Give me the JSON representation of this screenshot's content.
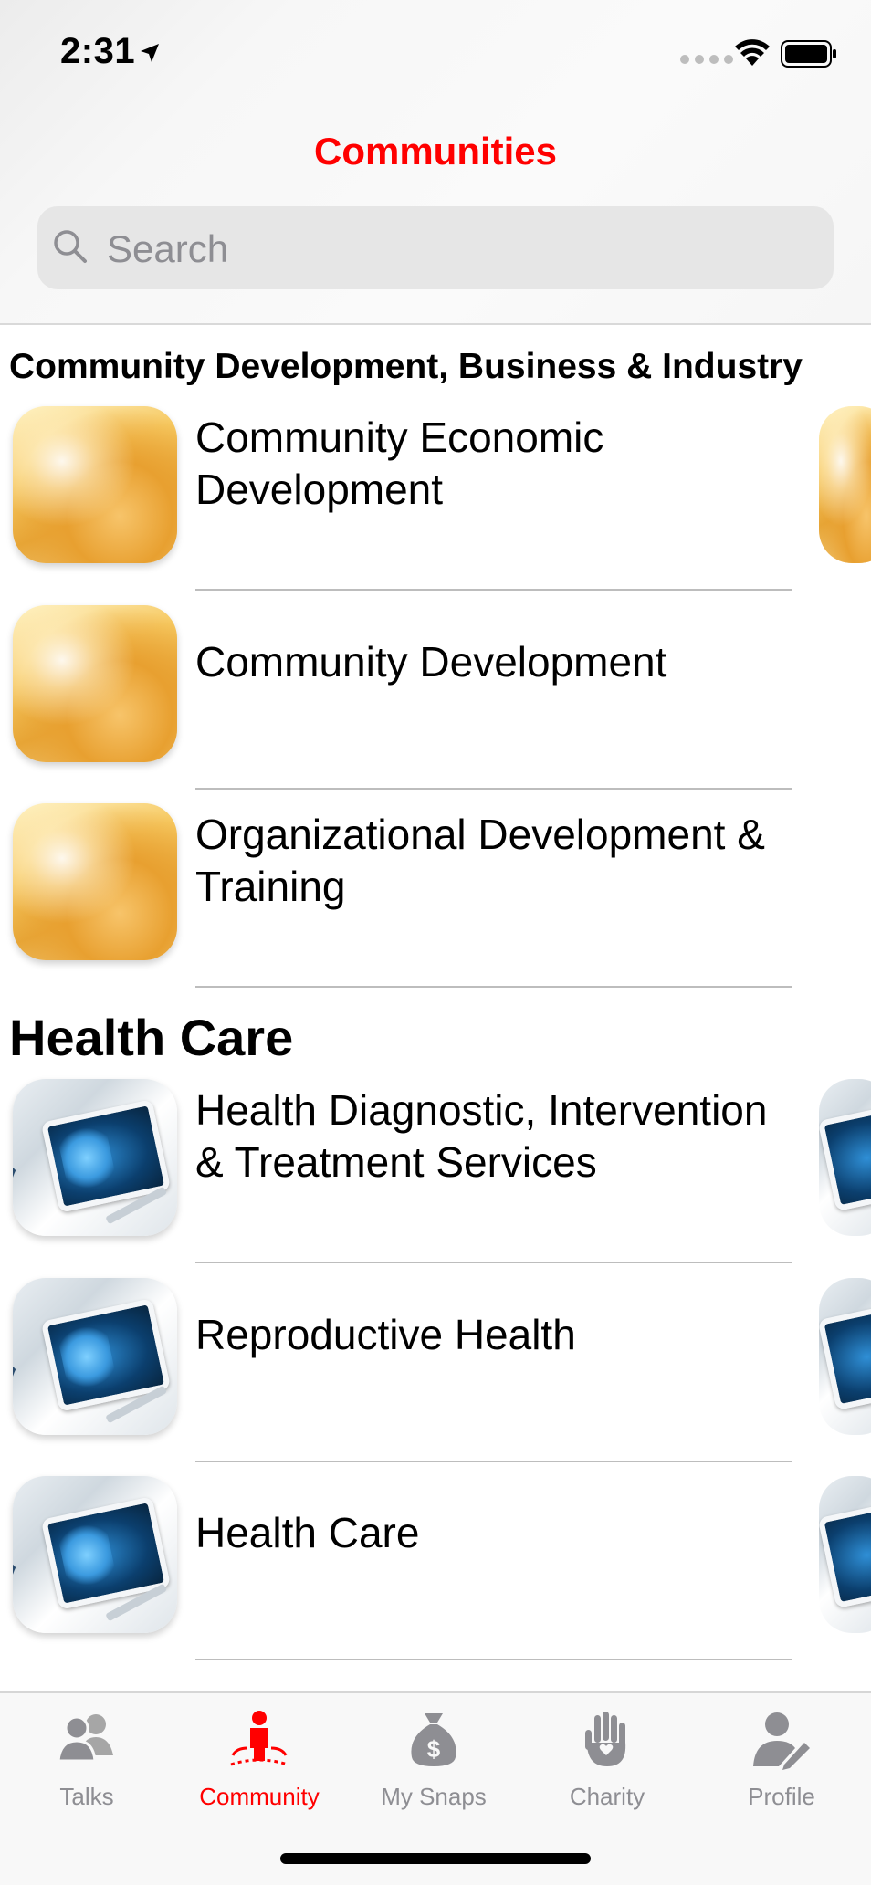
{
  "status_bar": {
    "time": "2:31"
  },
  "nav": {
    "title": "Communities"
  },
  "search": {
    "placeholder": "Search"
  },
  "sections": [
    {
      "title": "Community Development, Business & Industry",
      "items": [
        {
          "label": "Community Economic Development"
        },
        {
          "label": "Community Development"
        },
        {
          "label": "Organizational Development & Training"
        }
      ]
    },
    {
      "title": "Health Care",
      "items": [
        {
          "label": "Health Diagnostic, Intervention & Treatment Services"
        },
        {
          "label": "Reproductive Health"
        },
        {
          "label": "Health Care"
        }
      ]
    }
  ],
  "tabbar": {
    "tabs": [
      {
        "label": "Talks",
        "icon": "talks-icon"
      },
      {
        "label": "Community",
        "icon": "community-icon",
        "active": true
      },
      {
        "label": "My Snaps",
        "icon": "money-bag-icon"
      },
      {
        "label": "Charity",
        "icon": "charity-hand-icon"
      },
      {
        "label": "Profile",
        "icon": "profile-edit-icon"
      }
    ]
  },
  "colors": {
    "accent": "#ff0000",
    "inactive": "#8e8e93"
  }
}
